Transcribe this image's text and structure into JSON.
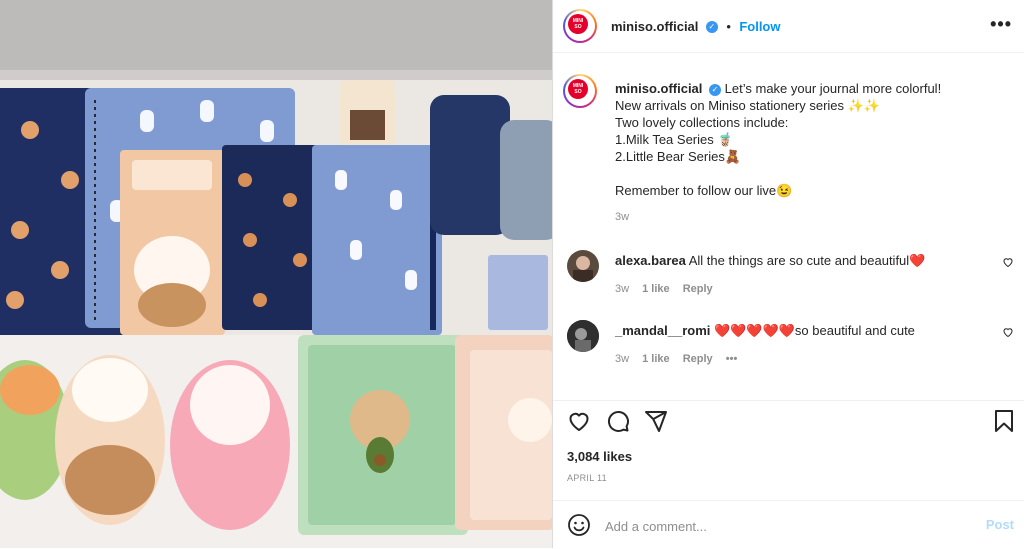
{
  "post": {
    "username": "miniso.official",
    "verified_icon": "verified-badge-icon",
    "follow_label": "Follow",
    "dot": "•",
    "more": "•••",
    "avatar_text_top": "MINI",
    "avatar_text_bottom": "SO"
  },
  "caption": {
    "username": "miniso.official",
    "lines": [
      "Let’s make your journal more colorful!",
      "New arrivals on Miniso stationery series ✨✨",
      "Two lovely collections include:",
      "1.Milk Tea Series 🧋",
      "2.Little Bear Series🧸",
      "",
      "Remember to follow our live😉"
    ],
    "time": "3w"
  },
  "comments": [
    {
      "username": "alexa.barea",
      "text": "All the things are so cute and beautiful❤️",
      "time": "3w",
      "likes": "1 like",
      "reply": "Reply"
    },
    {
      "username": "_mandal__romi",
      "text": "❤️❤️❤️❤️❤️so beautiful and cute",
      "time": "3w",
      "likes": "1 like",
      "reply": "Reply",
      "more": "•••"
    }
  ],
  "actions": {
    "like_icon": "heart-icon",
    "comment_icon": "comment-icon",
    "share_icon": "paper-plane-icon",
    "save_icon": "bookmark-icon"
  },
  "likes_count": "3,084 likes",
  "date": "APRIL 11",
  "add_comment": {
    "placeholder": "Add a comment...",
    "post_label": "Post",
    "emoji_icon": "smiley-icon"
  },
  "colors": {
    "accent": "#0095f6",
    "post_disabled": "#b3dbff",
    "heart_red": "#ed4956",
    "muted": "#8e8e8e"
  }
}
